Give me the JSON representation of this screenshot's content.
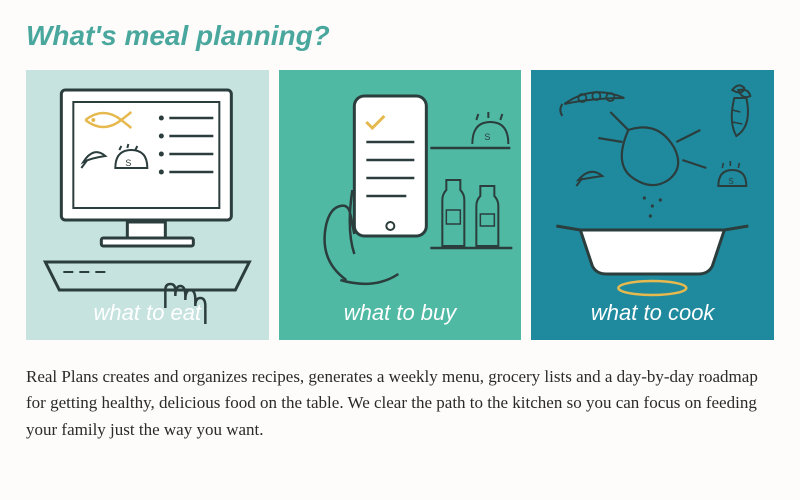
{
  "heading": "What's meal planning?",
  "cards": [
    {
      "label": "what to eat"
    },
    {
      "label": "what to buy"
    },
    {
      "label": "what to cook"
    }
  ],
  "description": "Real Plans creates and organizes recipes, generates a weekly menu, grocery lists and a day-by-day roadmap for getting healthy, delicious food on the table. We clear the path to the kitchen so you can focus on feeding your family just the way you want.",
  "colors": {
    "accent": "#4aa79e",
    "card_eat": "#c6e3df",
    "card_buy": "#4fb9a4",
    "card_cook": "#1f8a9e"
  }
}
